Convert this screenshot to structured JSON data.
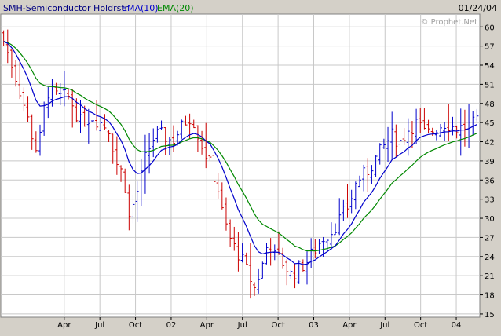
{
  "header": {
    "symbol_label": "SMH-Semiconductor Holdrstr",
    "ema10_label": "EMA(10)",
    "ema20_label": "EMA(20)",
    "date_label": "01/24/04",
    "watermark": "© Prophet.Net"
  },
  "colors": {
    "up_bar": "#0000cc",
    "down_bar": "#cc0000",
    "ema10": "#0000cc",
    "ema20": "#008800",
    "plot_bg": "#ffffff",
    "frame_bg": "#d4d0c8",
    "grid": "#c8c8c8"
  },
  "chart_data": {
    "type": "bar",
    "subtype": "weekly OHLC price bars with moving averages",
    "title": "SMH-Semiconductor Holdrstr",
    "date": "01/24/04",
    "x_ticks": [
      "Apr",
      "Jul",
      "Oct",
      "02",
      "Apr",
      "Jul",
      "Oct",
      "03",
      "Apr",
      "Jul",
      "Oct",
      "04"
    ],
    "x_tick_positions": [
      0.0625,
      0.1875,
      0.3125,
      0.4375,
      0.5625,
      0.6875,
      0.8125,
      0.9375,
      1.0625,
      1.1875,
      1.3125,
      1.4375
    ],
    "x_range": [
      -0.16,
      1.52
    ],
    "y_ticks": [
      15,
      18,
      21,
      24,
      27,
      30,
      33,
      36,
      39,
      42,
      45,
      48,
      51,
      54,
      57,
      60
    ],
    "ylim": [
      14.5,
      62
    ],
    "y_axis_side": "right",
    "grid": true,
    "legend": "top-left",
    "ema10_name": "EMA(10)",
    "ema20_name": "EMA(20)",
    "close_anchors": [
      [
        -0.16,
        59
      ],
      [
        -0.12,
        54
      ],
      [
        -0.08,
        48
      ],
      [
        -0.05,
        43
      ],
      [
        -0.03,
        40
      ],
      [
        0.0,
        50
      ],
      [
        0.04,
        49
      ],
      [
        0.08,
        49
      ],
      [
        0.12,
        45
      ],
      [
        0.16,
        46
      ],
      [
        0.19,
        45
      ],
      [
        0.22,
        44
      ],
      [
        0.25,
        38
      ],
      [
        0.27,
        37
      ],
      [
        0.29,
        30
      ],
      [
        0.31,
        33
      ],
      [
        0.33,
        36
      ],
      [
        0.35,
        40
      ],
      [
        0.38,
        43
      ],
      [
        0.41,
        43
      ],
      [
        0.44,
        42
      ],
      [
        0.47,
        44
      ],
      [
        0.5,
        46
      ],
      [
        0.52,
        45
      ],
      [
        0.54,
        42
      ],
      [
        0.57,
        39
      ],
      [
        0.6,
        35
      ],
      [
        0.62,
        30
      ],
      [
        0.65,
        26
      ],
      [
        0.68,
        24
      ],
      [
        0.71,
        21
      ],
      [
        0.73,
        19
      ],
      [
        0.76,
        23
      ],
      [
        0.78,
        27
      ],
      [
        0.8,
        24
      ],
      [
        0.83,
        23
      ],
      [
        0.86,
        21
      ],
      [
        0.88,
        22
      ],
      [
        0.91,
        23
      ],
      [
        0.94,
        25
      ],
      [
        0.97,
        27
      ],
      [
        1.0,
        28
      ],
      [
        1.03,
        30
      ],
      [
        1.06,
        32
      ],
      [
        1.09,
        36
      ],
      [
        1.12,
        37
      ],
      [
        1.15,
        39
      ],
      [
        1.18,
        41
      ],
      [
        1.21,
        43
      ],
      [
        1.24,
        42
      ],
      [
        1.27,
        44
      ],
      [
        1.3,
        45
      ],
      [
        1.33,
        43
      ],
      [
        1.36,
        44
      ],
      [
        1.4,
        45
      ],
      [
        1.44,
        44
      ],
      [
        1.52,
        45
      ]
    ],
    "series": [
      {
        "name": "SMH-Semiconductor Holdrstr",
        "kind": "ohlc",
        "range": [
          17.5,
          62
        ]
      },
      {
        "name": "EMA(10)",
        "kind": "line"
      },
      {
        "name": "EMA(20)",
        "kind": "line"
      }
    ]
  }
}
